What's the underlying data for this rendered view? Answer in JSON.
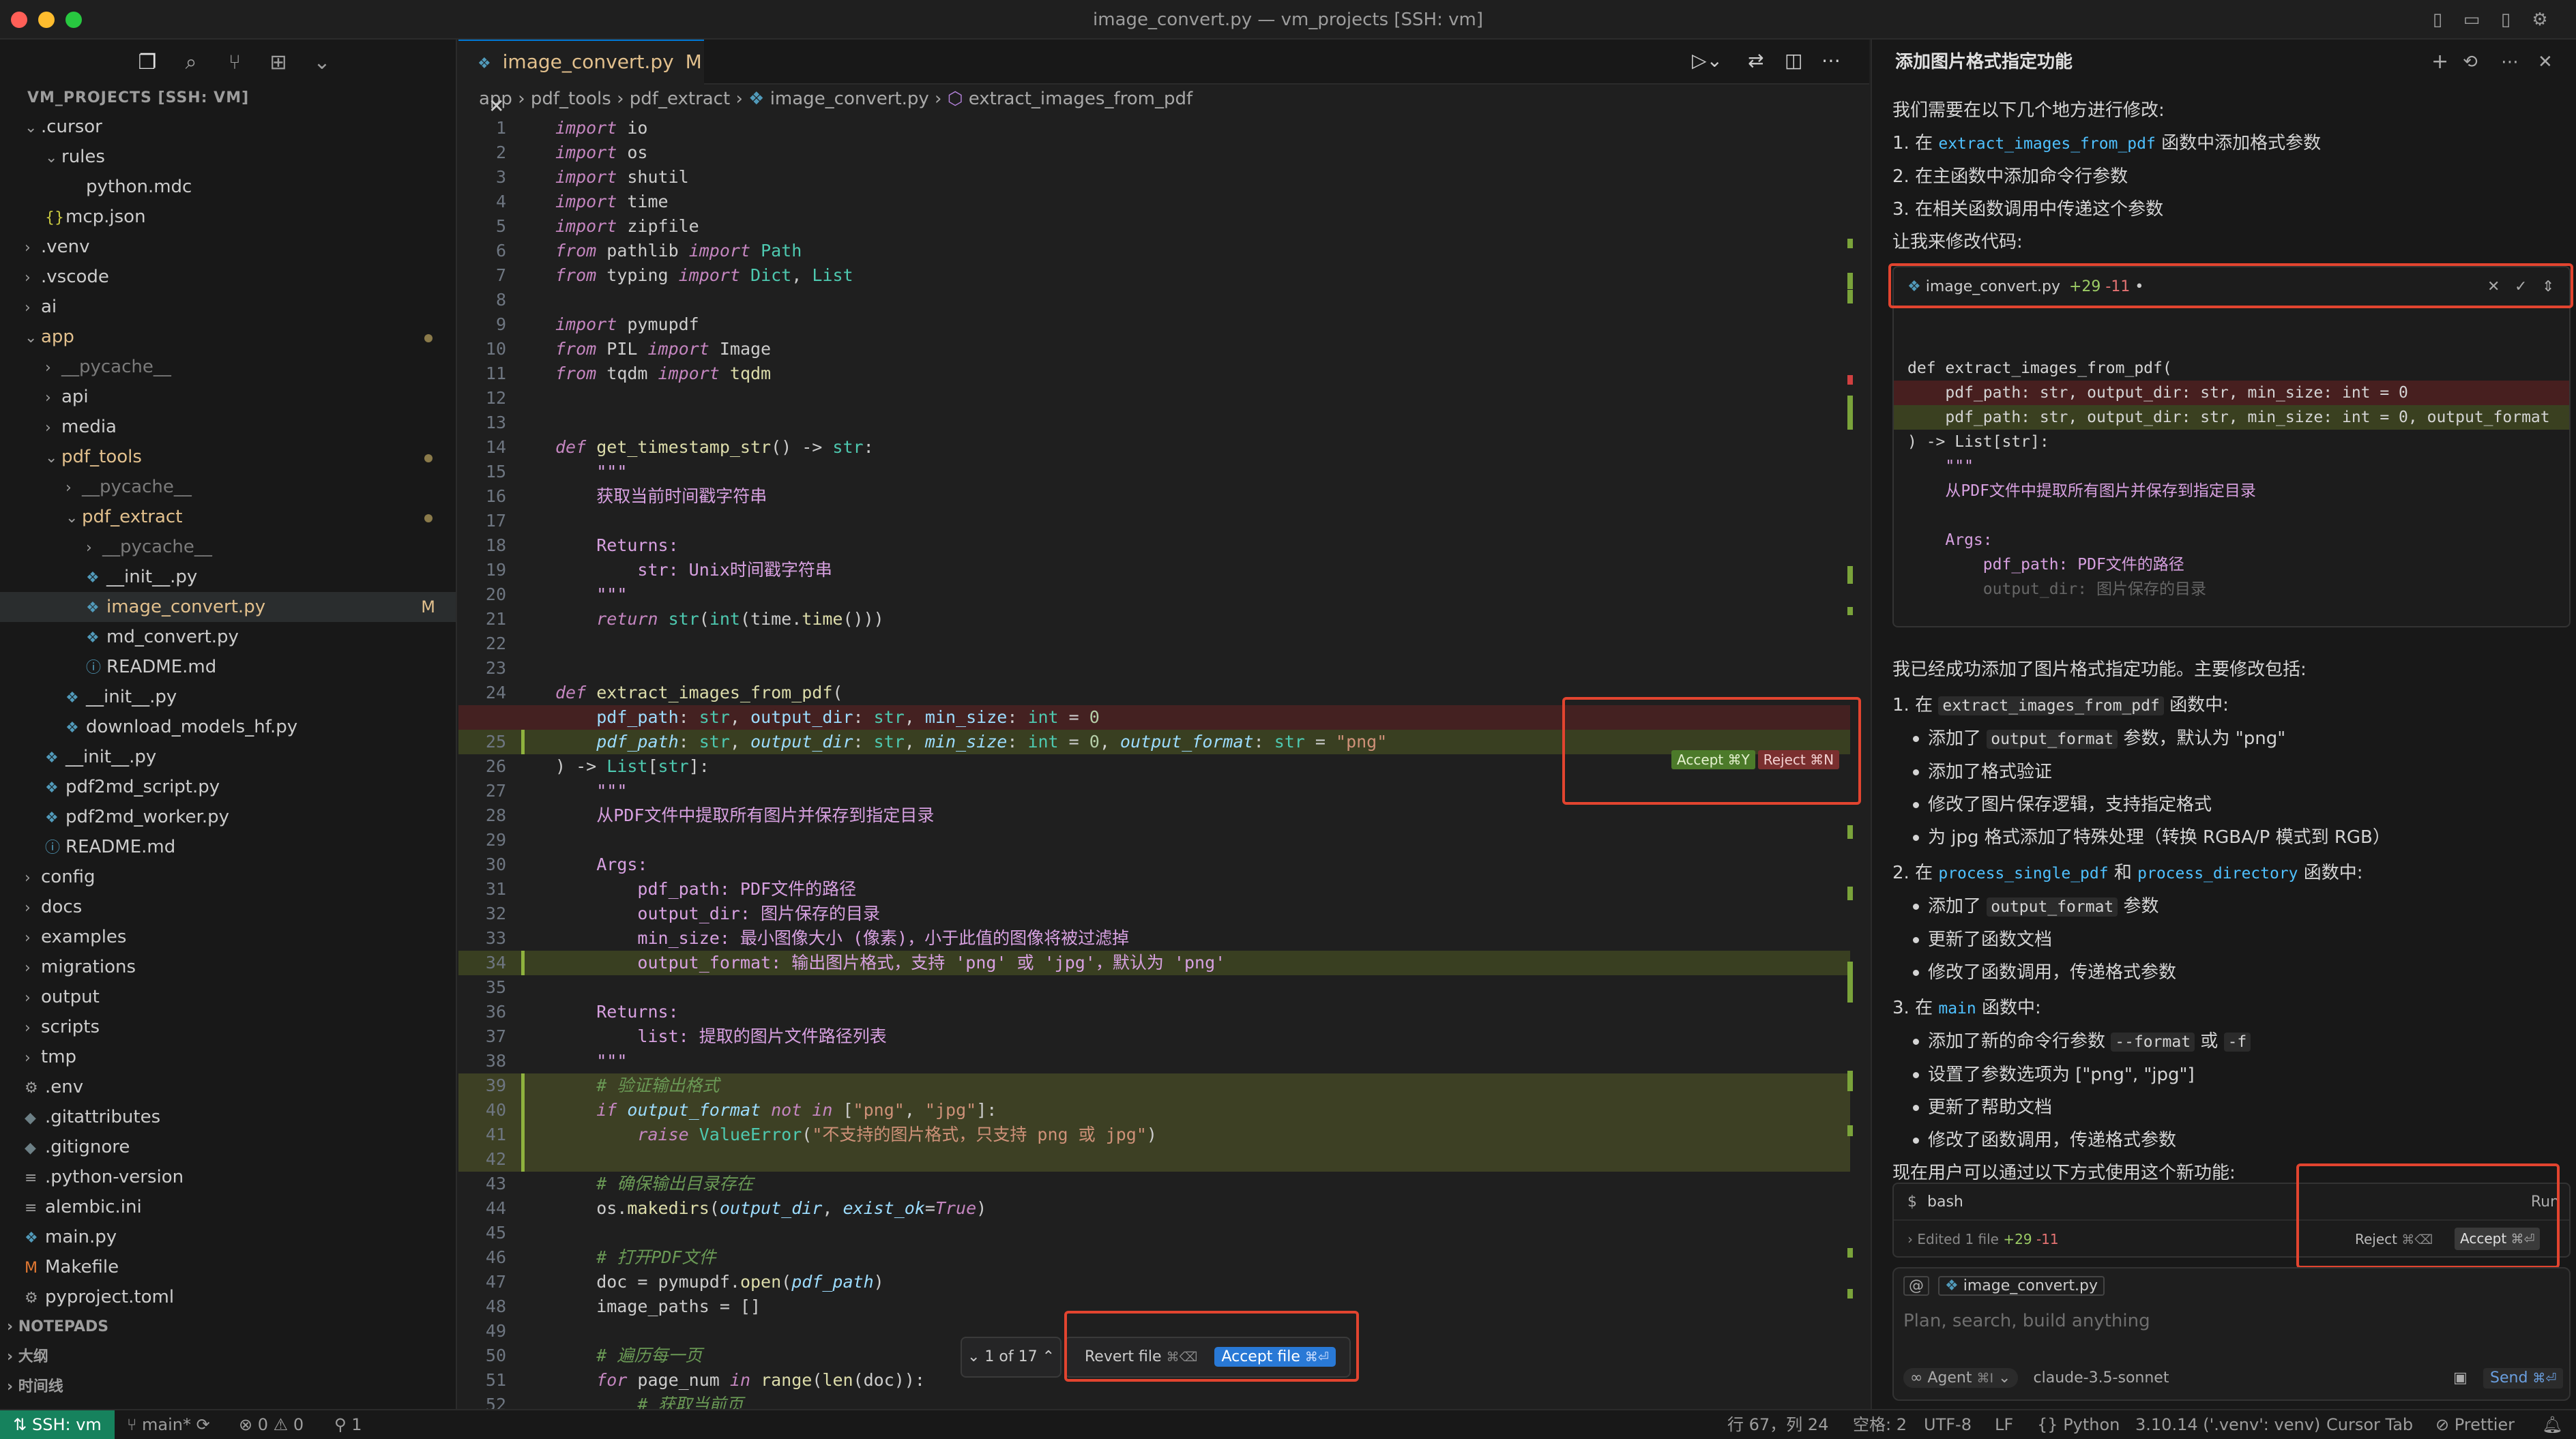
{
  "window": {
    "title": "image_convert.py — vm_projects [SSH: vm]"
  },
  "explorer": {
    "header": "VM_PROJECTS [SSH: VM]",
    "items": [
      {
        "label": ".cursor",
        "indent": 0,
        "kind": "folder-open"
      },
      {
        "label": "rules",
        "indent": 1,
        "kind": "folder-open"
      },
      {
        "label": "python.mdc",
        "indent": 2,
        "kind": "file"
      },
      {
        "label": "mcp.json",
        "indent": 1,
        "kind": "json"
      },
      {
        "label": ".venv",
        "indent": 0,
        "kind": "folder"
      },
      {
        "label": ".vscode",
        "indent": 0,
        "kind": "folder"
      },
      {
        "label": "ai",
        "indent": 0,
        "kind": "folder"
      },
      {
        "label": "app",
        "indent": 0,
        "kind": "folder-open",
        "mod": true
      },
      {
        "label": "__pycache__",
        "indent": 1,
        "kind": "folder",
        "dim": true
      },
      {
        "label": "api",
        "indent": 1,
        "kind": "folder"
      },
      {
        "label": "media",
        "indent": 1,
        "kind": "folder"
      },
      {
        "label": "pdf_tools",
        "indent": 1,
        "kind": "folder-open",
        "mod": true
      },
      {
        "label": "__pycache__",
        "indent": 2,
        "kind": "folder",
        "dim": true
      },
      {
        "label": "pdf_extract",
        "indent": 2,
        "kind": "folder-open",
        "mod": true
      },
      {
        "label": "__pycache__",
        "indent": 3,
        "kind": "folder",
        "dim": true
      },
      {
        "label": "__init__.py",
        "indent": 3,
        "kind": "py"
      },
      {
        "label": "image_convert.py",
        "indent": 3,
        "kind": "py",
        "selected": true,
        "badge": "M"
      },
      {
        "label": "md_convert.py",
        "indent": 3,
        "kind": "py"
      },
      {
        "label": "README.md",
        "indent": 3,
        "kind": "info"
      },
      {
        "label": "__init__.py",
        "indent": 2,
        "kind": "py"
      },
      {
        "label": "download_models_hf.py",
        "indent": 2,
        "kind": "py"
      },
      {
        "label": "__init__.py",
        "indent": 1,
        "kind": "py"
      },
      {
        "label": "pdf2md_script.py",
        "indent": 1,
        "kind": "py"
      },
      {
        "label": "pdf2md_worker.py",
        "indent": 1,
        "kind": "py"
      },
      {
        "label": "README.md",
        "indent": 1,
        "kind": "info"
      },
      {
        "label": "config",
        "indent": 0,
        "kind": "folder"
      },
      {
        "label": "docs",
        "indent": 0,
        "kind": "folder"
      },
      {
        "label": "examples",
        "indent": 0,
        "kind": "folder"
      },
      {
        "label": "migrations",
        "indent": 0,
        "kind": "folder"
      },
      {
        "label": "output",
        "indent": 0,
        "kind": "folder"
      },
      {
        "label": "scripts",
        "indent": 0,
        "kind": "folder"
      },
      {
        "label": "tmp",
        "indent": 0,
        "kind": "folder"
      },
      {
        "label": ".env",
        "indent": 0,
        "kind": "gear"
      },
      {
        "label": ".gitattributes",
        "indent": 0,
        "kind": "git"
      },
      {
        "label": ".gitignore",
        "indent": 0,
        "kind": "git"
      },
      {
        "label": ".python-version",
        "indent": 0,
        "kind": "lines"
      },
      {
        "label": "alembic.ini",
        "indent": 0,
        "kind": "lines"
      },
      {
        "label": "main.py",
        "indent": 0,
        "kind": "py"
      },
      {
        "label": "Makefile",
        "indent": 0,
        "kind": "make"
      },
      {
        "label": "pyproject.toml",
        "indent": 0,
        "kind": "gear"
      }
    ],
    "sections": [
      "NOTEPADS",
      "大纲",
      "时间线"
    ]
  },
  "editor": {
    "tab_label": "image_convert.py",
    "tab_badge": "M",
    "breadcrumb": [
      "app",
      "pdf_tools",
      "pdf_extract",
      "image_convert.py",
      "extract_images_from_pdf"
    ],
    "inline_accept": "Accept ⌘Y",
    "inline_reject": "Reject ⌘N",
    "nav_counter": "1 of 17",
    "revert_file": "Revert file",
    "revert_kbd": "⌘⌫",
    "accept_file": "Accept file",
    "accept_kbd": "⌘⏎"
  },
  "code": [
    {
      "n": "1",
      "html": "<span class='kw'>import</span> io"
    },
    {
      "n": "2",
      "html": "<span class='kw'>import</span> os"
    },
    {
      "n": "3",
      "html": "<span class='kw'>import</span> shutil"
    },
    {
      "n": "4",
      "html": "<span class='kw'>import</span> time"
    },
    {
      "n": "5",
      "html": "<span class='kw'>import</span> zipfile"
    },
    {
      "n": "6",
      "html": "<span class='kw'>from</span> pathlib <span class='kw'>import</span> <span class='ty'>Path</span>"
    },
    {
      "n": "7",
      "html": "<span class='kw'>from</span> typing <span class='kw'>import</span> <span class='ty'>Dict</span>, <span class='ty'>List</span>"
    },
    {
      "n": "8",
      "html": ""
    },
    {
      "n": "9",
      "html": "<span class='kw'>import</span> pymupdf"
    },
    {
      "n": "10",
      "html": "<span class='kw'>from</span> PIL <span class='kw'>import</span> Image"
    },
    {
      "n": "11",
      "html": "<span class='kw'>from</span> tqdm <span class='kw'>import</span> <span class='fn'>tqdm</span>"
    },
    {
      "n": "12",
      "html": ""
    },
    {
      "n": "13",
      "html": ""
    },
    {
      "n": "14",
      "html": "<span class='kw'>def</span> <span class='fn'>get_timestamp_str</span>() -&gt; <span class='ty'>str</span>:"
    },
    {
      "n": "15",
      "html": "    <span class='doc'>\"\"\"</span>"
    },
    {
      "n": "16",
      "html": "    <span class='doc'>获取当前时间戳字符串</span>"
    },
    {
      "n": "17",
      "html": ""
    },
    {
      "n": "18",
      "html": "    <span class='doc'>Returns:</span>"
    },
    {
      "n": "19",
      "html": "        <span class='doc'>str: Unix时间戳字符串</span>"
    },
    {
      "n": "20",
      "html": "    <span class='doc'>\"\"\"</span>"
    },
    {
      "n": "21",
      "html": "    <span class='kw'>return</span> <span class='ty'>str</span>(<span class='ty'>int</span>(time.<span class='fn'>time</span>()))"
    },
    {
      "n": "22",
      "html": ""
    },
    {
      "n": "23",
      "html": ""
    },
    {
      "n": "24",
      "html": "<span class='kw'>def</span> <span class='fn'>extract_images_from_pdf</span>("
    },
    {
      "n": "",
      "html": "    <span class='vr'>pdf_path</span>: <span class='ty'>str</span>, <span class='vr'>output_dir</span>: <span class='ty'>str</span>, <span class='vr'>min_size</span>: <span class='ty'>int</span> = <span class='nm'>0</span>",
      "cls": "del"
    },
    {
      "n": "25",
      "html": "    <span class='vr'><i>pdf_path</i></span>: <span class='ty'>str</span>, <span class='vr'><i>output_dir</i></span>: <span class='ty'>str</span>, <span class='vr'><i>min_size</i></span>: <span class='ty'>int</span> = <span class='nm'>0</span>, <span class='vr'><i>output_format</i></span>: <span class='ty'>str</span> = <span class='str'>\"png\"</span>",
      "cls": "add"
    },
    {
      "n": "26",
      "html": ") -&gt; <span class='ty'>List</span>[<span class='ty'>str</span>]:"
    },
    {
      "n": "27",
      "html": "    <span class='doc'>\"\"\"</span>"
    },
    {
      "n": "28",
      "html": "    <span class='doc'>从PDF文件中提取所有图片并保存到指定目录</span>"
    },
    {
      "n": "29",
      "html": ""
    },
    {
      "n": "30",
      "html": "    <span class='doc'>Args:</span>"
    },
    {
      "n": "31",
      "html": "        <span class='doc'>pdf_path: PDF文件的路径</span>"
    },
    {
      "n": "32",
      "html": "        <span class='doc'>output_dir: 图片保存的目录</span>"
    },
    {
      "n": "33",
      "html": "        <span class='doc'>min_size: 最小图像大小 (像素)，小于此值的图像将被过滤掉</span>"
    },
    {
      "n": "34",
      "html": "        <span class='doc'>output_format: 输出图片格式，支持 'png' 或 'jpg'，默认为 'png'</span>",
      "cls": "add"
    },
    {
      "n": "35",
      "html": ""
    },
    {
      "n": "36",
      "html": "    <span class='doc'>Returns:</span>"
    },
    {
      "n": "37",
      "html": "        <span class='doc'>list: 提取的图片文件路径列表</span>"
    },
    {
      "n": "38",
      "html": "    <span class='doc'>\"\"\"</span>"
    },
    {
      "n": "39",
      "html": "    <span class='cm'># 验证输出格式</span>",
      "cls": "addlight"
    },
    {
      "n": "40",
      "html": "    <span class='kw'>if</span> <span class='vr'><i>output_format</i></span> <span class='kw'>not in</span> [<span class='str'>\"png\"</span>, <span class='str'>\"jpg\"</span>]:",
      "cls": "addlight"
    },
    {
      "n": "41",
      "html": "        <span class='kw'>raise</span> <span class='ty'>ValueError</span>(<span class='str'>\"不支持的图片格式，只支持 png 或 jpg\"</span>)",
      "cls": "addlight"
    },
    {
      "n": "42",
      "html": "",
      "cls": "addlight"
    },
    {
      "n": "43",
      "html": "    <span class='cm'># 确保输出目录存在</span>"
    },
    {
      "n": "44",
      "html": "    os.<span class='fn'>makedirs</span>(<span class='vr'><i>output_dir</i></span>, <span class='vr'><i>exist_ok</i></span>=<span class='kw'>True</span>)"
    },
    {
      "n": "45",
      "html": ""
    },
    {
      "n": "46",
      "html": "    <span class='cm'># 打开PDF文件</span>"
    },
    {
      "n": "47",
      "html": "    doc = pymupdf.<span class='fn'>open</span>(<span class='vr'><i>pdf_path</i></span>)"
    },
    {
      "n": "48",
      "html": "    image_paths = []"
    },
    {
      "n": "49",
      "html": ""
    },
    {
      "n": "50",
      "html": "    <span class='cm'># 遍历每一页</span>"
    },
    {
      "n": "51",
      "html": "    <span class='kw'>for</span> page_num <span class='kw'>in</span> <span class='fn'>range</span>(<span class='fn'>len</span>(doc)):"
    },
    {
      "n": "52",
      "html": "        <span class='cm'># 获取当前页</span>"
    }
  ],
  "chat": {
    "title": "添加图片格式指定功能",
    "intro": "我们需要在以下几个地方进行修改:",
    "steps": [
      {
        "pre": "1. 在 ",
        "code": "extract_images_from_pdf",
        "post": " 函数中添加格式参数"
      },
      {
        "pre": "2. 在主函数中添加命令行参数",
        "code": "",
        "post": ""
      },
      {
        "pre": "3. 在相关函数调用中传递这个参数",
        "code": "",
        "post": ""
      }
    ],
    "lets_modify": "让我来修改代码:",
    "diff_file": "image_convert.py",
    "diff_stats_add": "+29",
    "diff_stats_del": "-11",
    "diff_code": [
      {
        "text": "def extract_images_from_pdf(",
        "cls": ""
      },
      {
        "text": "    pdf_path: str, output_dir: str, min_size: int = 0",
        "cls": "del"
      },
      {
        "text": "    pdf_path: str, output_dir: str, min_size: int = 0, output_format",
        "cls": "add"
      },
      {
        "text": ") -> List[str]:",
        "cls": ""
      },
      {
        "text": "    \"\"\"",
        "cls": ""
      },
      {
        "text": "    从PDF文件中提取所有图片并保存到指定目录",
        "cls": ""
      },
      {
        "text": "",
        "cls": ""
      },
      {
        "text": "    Args:",
        "cls": ""
      },
      {
        "text": "        pdf_path: PDF文件的路径",
        "cls": ""
      },
      {
        "text": "        output_dir: 图片保存的目录",
        "cls": "fade"
      }
    ],
    "summary": "我已经成功添加了图片格式指定功能。主要修改包括:",
    "sec1_pre": "1. 在 ",
    "sec1_code": "extract_images_from_pdf",
    "sec1_post": " 函数中:",
    "sec1_items": [
      {
        "pre": "添加了 ",
        "code": "output_format",
        "post": " 参数，默认为 \"png\""
      },
      {
        "pre": "添加了格式验证",
        "code": "",
        "post": ""
      },
      {
        "pre": "修改了图片保存逻辑，支持指定格式",
        "code": "",
        "post": ""
      },
      {
        "pre": "为 jpg 格式添加了特殊处理（转换 RGBA/P 模式到 RGB）",
        "code": "",
        "post": ""
      }
    ],
    "sec2_pre": "2. 在 ",
    "sec2_link1": "process_single_pdf",
    "sec2_mid": " 和 ",
    "sec2_link2": "process_directory",
    "sec2_post": " 函数中:",
    "sec2_items": [
      {
        "pre": "添加了 ",
        "code": "output_format",
        "post": " 参数"
      },
      {
        "pre": "更新了函数文档",
        "code": "",
        "post": ""
      },
      {
        "pre": "修改了函数调用，传递格式参数",
        "code": "",
        "post": ""
      }
    ],
    "sec3_pre": "3. 在 ",
    "sec3_link": "main",
    "sec3_post": " 函数中:",
    "sec3_items": [
      {
        "pre": "添加了新的命令行参数 ",
        "code": "--format",
        "mid": " 或 ",
        "code2": "-f",
        "post": ""
      },
      {
        "pre": "设置了参数选项为 [\"png\", \"jpg\"]",
        "code": "",
        "post": ""
      },
      {
        "pre": "更新了帮助文档",
        "code": "",
        "post": ""
      },
      {
        "pre": "修改了函数调用，传递格式参数",
        "code": "",
        "post": ""
      }
    ],
    "usage": "现在用户可以通过以下方式使用这个新功能:",
    "bash_label": "bash",
    "run_label": "Run",
    "edited_summary": "Edited 1 file",
    "edited_add": "+29",
    "edited_del": "-11",
    "reject_label": "Reject",
    "reject_kbd": "⌘⌫",
    "accept_label": "Accept",
    "accept_kbd": "⌘⏎",
    "context_file": "image_convert.py",
    "input_placeholder": "Plan, search, build anything",
    "agent_label": "Agent",
    "agent_kbd": "⌘I",
    "model": "claude-3.5-sonnet",
    "send_label": "Send",
    "send_kbd": "⌘⏎"
  },
  "statusbar": {
    "ssh": "SSH: vm",
    "branch": "main*",
    "errors": "0",
    "warnings": "0",
    "ports": "1",
    "position": "行 67，列 24",
    "spaces": "空格: 2",
    "encoding": "UTF-8",
    "eol": "LF",
    "language": "Python",
    "interpreter": "3.10.14 ('.venv': venv)",
    "cursor_tab": "Cursor Tab",
    "prettier": "Prettier"
  }
}
